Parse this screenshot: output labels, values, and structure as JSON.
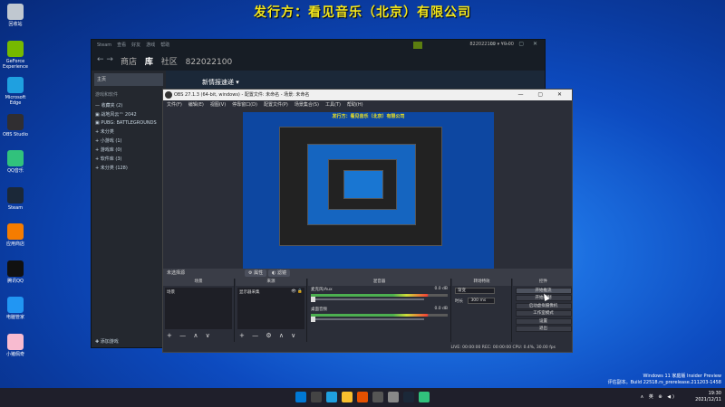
{
  "banner": {
    "text": "发行方：看见音乐（北京）有限公司"
  },
  "desktop_icons": [
    {
      "label": "回收站",
      "color": "#c0c8d0"
    },
    {
      "label": "GeForce Experience",
      "color": "#76b900"
    },
    {
      "label": "Microsoft Edge",
      "color": "#1fa0e0"
    },
    {
      "label": "OBS Studio",
      "color": "#302e31"
    },
    {
      "label": "QQ音乐",
      "color": "#31c27c"
    },
    {
      "label": "Steam",
      "color": "#1b2838"
    },
    {
      "label": "应用商店",
      "color": "#f57c00"
    },
    {
      "label": "腾讯QQ",
      "color": "#111111"
    },
    {
      "label": "电脑管家",
      "color": "#2196f3"
    },
    {
      "label": "小猪佩奇",
      "color": "#f8bbd0"
    }
  ],
  "steam": {
    "menu": [
      "Steam",
      "查看",
      "好友",
      "游戏",
      "帮助"
    ],
    "user": "822022100 ▾  ¥0.00",
    "window_buttons": "▭ — ▢ ✕",
    "nav_arrows": "← →",
    "tabs": [
      {
        "label": "商店"
      },
      {
        "label": "库"
      },
      {
        "label": "社区"
      },
      {
        "label": "822022100"
      }
    ],
    "home_label": "主页",
    "section_label": "游戏和软件",
    "items": [
      "— 收藏夹 (2)",
      "▣ 战地风云™ 2042",
      "▣ PUBG: BATTLEGROUNDS",
      "+ 未分类",
      "+ 小游戏 (1)",
      "+ 游戏库 (0)",
      "+ 软件库 (3)",
      "+ 未分类 (128)"
    ],
    "add_game": "✚ 添加游戏",
    "news_title": "新情报速递 ▾"
  },
  "obs": {
    "title": "OBS 27.1.3 (64-bit, windows) - 配置文件: 未命名 - 场景: 未命名",
    "window_buttons": "— ▢ ✕",
    "menu": [
      "文件(F)",
      "编辑(E)",
      "视图(V)",
      "停靠窗口(D)",
      "配置文件(P)",
      "场景集合(S)",
      "工具(T)",
      "帮助(H)"
    ],
    "preview_banner": "发行方：看见音乐（北京）有限公司",
    "info_left": "未选择源",
    "info_btn1": "⚙ 属性",
    "info_btn2": "◐ 滤镜",
    "dock_titles": [
      "场景",
      "来源",
      "混音器",
      "转场特效",
      "控件"
    ],
    "scene_item": "场景",
    "source_item": "显示器采集",
    "source_icons": "👁 🔒",
    "dock_tools": "+ — ∧ ∨",
    "source_tools": "+ — ⚙ ∧ ∨",
    "mixer": [
      {
        "name": "麦克风/Aux",
        "db": "0.0 dB"
      },
      {
        "name": "桌面音频",
        "db": "0.0 dB"
      }
    ],
    "transition_label": "渐变",
    "duration_label": "时长",
    "duration_value": "300 ms",
    "controls": [
      "开始推流",
      "开始录制",
      "启动虚拟摄像机",
      "工作室模式",
      "设置",
      "退出"
    ],
    "status": "LIVE: 00:00:00   REC: 00:00:00   CPU: 0.4%, 30.00 fps"
  },
  "watermark": {
    "line1": "Windows 11 家庭版 Insider Preview",
    "line2": "评估副本。Build 22518.rs_prerelease.211203-1458"
  },
  "taskbar": {
    "icons": [
      {
        "color": "#0078d4"
      },
      {
        "color": "#444444"
      },
      {
        "color": "#1fa0e0"
      },
      {
        "color": "#f9c02e"
      },
      {
        "color": "#e65100"
      },
      {
        "color": "#555555"
      },
      {
        "color": "#888888"
      },
      {
        "color": "#1b2838"
      },
      {
        "color": "#31c27c"
      }
    ],
    "tray": "∧ 英 ⊕ ◀)",
    "time": "19:30",
    "date": "2021/12/11"
  }
}
